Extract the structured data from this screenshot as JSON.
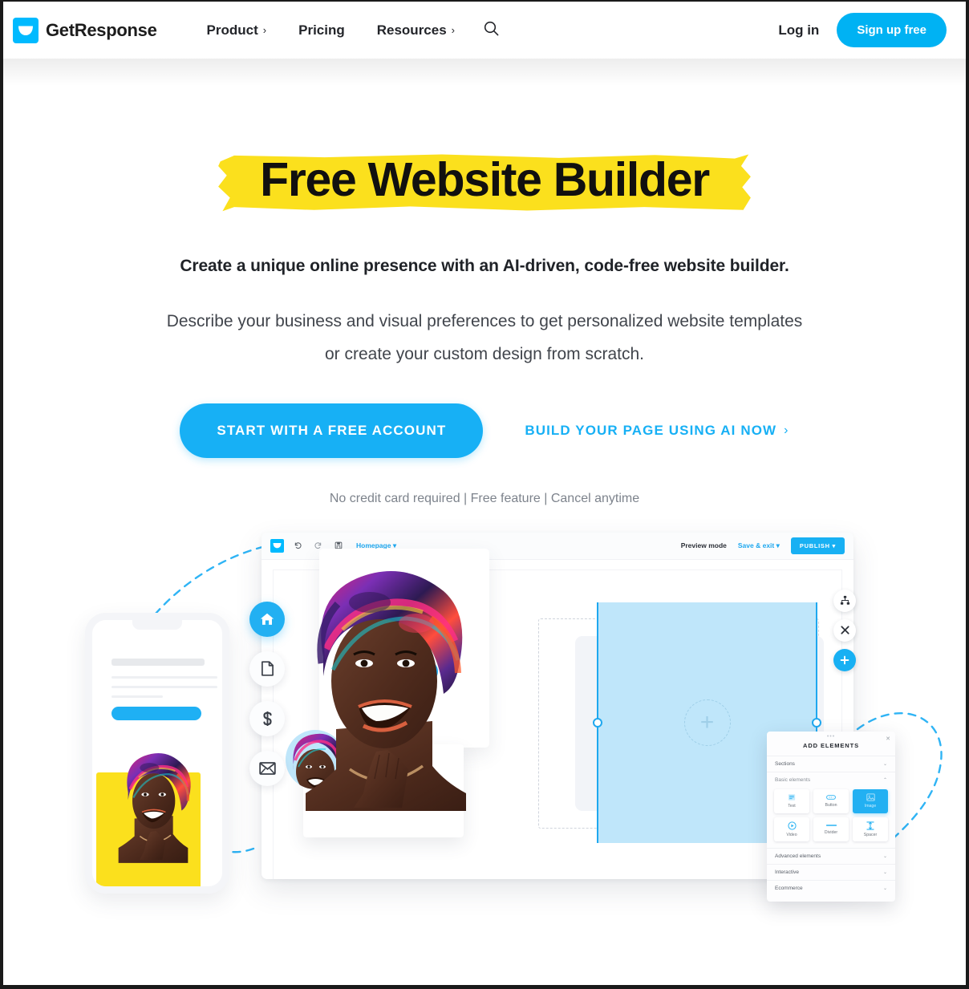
{
  "header": {
    "brand_name": "GetResponse",
    "brand_icon": "envelope-logo-icon",
    "nav": [
      {
        "label": "Product",
        "caret": "›",
        "has_caret": true
      },
      {
        "label": "Pricing",
        "caret": "",
        "has_caret": false
      },
      {
        "label": "Resources",
        "caret": "›",
        "has_caret": true
      }
    ],
    "search_icon": "search-icon",
    "login_label": "Log in",
    "signup_label": "Sign up free",
    "accent_color": "#00b2f3"
  },
  "hero": {
    "title": "Free Website Builder",
    "highlight_color": "#fbe01d",
    "subtitle": "Create a unique online presence with an AI-driven, code-free website builder.",
    "lead_line1": "Describe your business and visual preferences to get personalized website templates",
    "lead_line2": "or create your custom design from scratch.",
    "cta_primary": "START WITH A FREE ACCOUNT",
    "cta_secondary": "BUILD YOUR PAGE USING AI NOW",
    "cta_secondary_chevron": "›",
    "note": "No credit card required | Free feature | Cancel anytime"
  },
  "builder": {
    "toolbar": {
      "logo_icon": "envelope-logo-icon",
      "undo_icon": "undo-icon",
      "redo_icon": "redo-icon",
      "save_icon": "save-icon",
      "page_label": "Homepage",
      "page_caret": "▾",
      "preview_label": "Preview mode",
      "save_exit_label": "Save & exit",
      "save_exit_caret": "▾",
      "publish_label": "PUBLISH",
      "publish_caret": "▾"
    },
    "left_nav": [
      {
        "icon": "home-icon",
        "active": true
      },
      {
        "icon": "page-icon",
        "active": false
      },
      {
        "icon": "dollar-icon",
        "active": false
      },
      {
        "icon": "envelope-icon",
        "active": false
      }
    ],
    "right_controls": [
      {
        "icon": "sitemap-icon",
        "kind": "plain"
      },
      {
        "icon": "close-icon",
        "kind": "plain"
      },
      {
        "icon": "plus-icon",
        "kind": "add"
      }
    ],
    "selection": {
      "placeholder_icon": "plus-circle-icon",
      "handle_color": "#1fa8ef"
    },
    "panel": {
      "grip": "•••",
      "close_icon": "close-icon",
      "title": "ADD ELEMENTS",
      "sections": [
        {
          "label": "Sections",
          "caret": "⌄",
          "expanded": false
        },
        {
          "label": "Basic elements",
          "caret": "⌃",
          "expanded": true
        }
      ],
      "elements": [
        {
          "label": "Text",
          "icon": "text-icon",
          "selected": false
        },
        {
          "label": "Button",
          "icon": "button-icon",
          "selected": false
        },
        {
          "label": "Image",
          "icon": "image-icon",
          "selected": true
        },
        {
          "label": "Video",
          "icon": "video-icon",
          "selected": false
        },
        {
          "label": "Divider",
          "icon": "divider-icon",
          "selected": false
        },
        {
          "label": "Spacer",
          "icon": "spacer-icon",
          "selected": false
        }
      ],
      "footer_sections": [
        {
          "label": "Advanced elements",
          "caret": "⌄"
        },
        {
          "label": "Interactive",
          "caret": "⌄"
        },
        {
          "label": "Ecommerce",
          "caret": "⌄"
        }
      ]
    }
  }
}
